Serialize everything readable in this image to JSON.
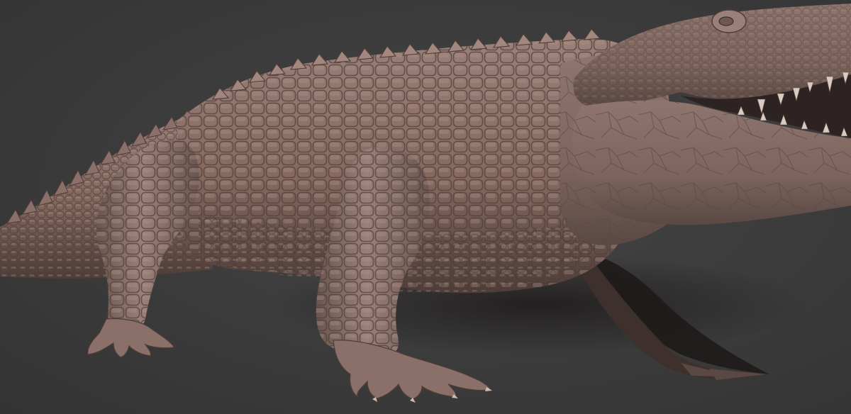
{
  "scene": {
    "subject": "crocodile-sculpt",
    "colors": {
      "background": "#3a3a3a",
      "skin_light": "#9a8078",
      "skin_mid": "#7d645d",
      "skin_dark": "#4e3d38",
      "shadow": "#1e1b1a",
      "teeth": "#d8cbbf",
      "mouth": "#2c2322"
    }
  }
}
